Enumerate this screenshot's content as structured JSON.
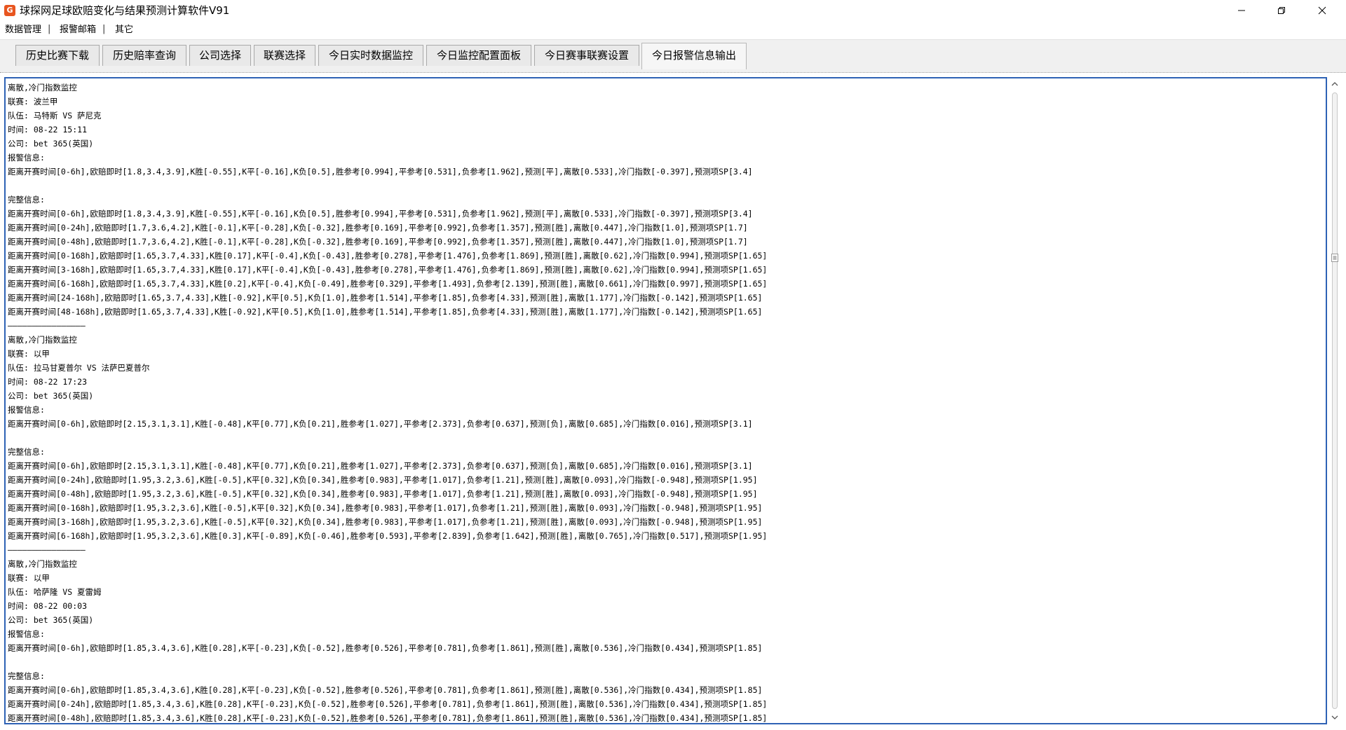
{
  "window": {
    "icon_glyph": "G",
    "title": "球探网足球欧赔变化与结果预测计算软件V91",
    "controls": [
      "minimize-icon",
      "restore-icon",
      "close-icon"
    ]
  },
  "menu": {
    "items": [
      "数据管理",
      "报警邮箱",
      "其它"
    ],
    "separator": "|"
  },
  "tabs": [
    {
      "label": "历史比赛下载",
      "active": false
    },
    {
      "label": "历史赔率查询",
      "active": false
    },
    {
      "label": "公司选择",
      "active": false
    },
    {
      "label": "联赛选择",
      "active": false
    },
    {
      "label": "今日实时数据监控",
      "active": false
    },
    {
      "label": "今日监控配置面板",
      "active": false
    },
    {
      "label": "今日赛事联赛设置",
      "active": false
    },
    {
      "label": "今日报警信息输出",
      "active": true
    }
  ],
  "colors": {
    "accent_border": "#2e62b5",
    "tab_bg": "#e9e9e9",
    "active_tab_bg": "#f6f6f6"
  },
  "log_lines": [
    "离散,冷门指数监控",
    "联赛: 波兰甲",
    "队伍: 马特斯 VS 萨尼克",
    "时间: 08-22 15:11",
    "公司: bet 365(英国)",
    "报警信息:",
    "距离开赛时间[0-6h],欧赔即时[1.8,3.4,3.9],K胜[-0.55],K平[-0.16],K负[0.5],胜参考[0.994],平参考[0.531],负参考[1.962],预测[平],离散[0.533],冷门指数[-0.397],预测项SP[3.4]",
    "",
    "完整信息:",
    "距离开赛时间[0-6h],欧赔即时[1.8,3.4,3.9],K胜[-0.55],K平[-0.16],K负[0.5],胜参考[0.994],平参考[0.531],负参考[1.962],预测[平],离散[0.533],冷门指数[-0.397],预测项SP[3.4]",
    "距离开赛时间[0-24h],欧赔即时[1.7,3.6,4.2],K胜[-0.1],K平[-0.28],K负[-0.32],胜参考[0.169],平参考[0.992],负参考[1.357],预测[胜],离散[0.447],冷门指数[1.0],预测项SP[1.7]",
    "距离开赛时间[0-48h],欧赔即时[1.7,3.6,4.2],K胜[-0.1],K平[-0.28],K负[-0.32],胜参考[0.169],平参考[0.992],负参考[1.357],预测[胜],离散[0.447],冷门指数[1.0],预测项SP[1.7]",
    "距离开赛时间[0-168h],欧赔即时[1.65,3.7,4.33],K胜[0.17],K平[-0.4],K负[-0.43],胜参考[0.278],平参考[1.476],负参考[1.869],预测[胜],离散[0.62],冷门指数[0.994],预测项SP[1.65]",
    "距离开赛时间[3-168h],欧赔即时[1.65,3.7,4.33],K胜[0.17],K平[-0.4],K负[-0.43],胜参考[0.278],平参考[1.476],负参考[1.869],预测[胜],离散[0.62],冷门指数[0.994],预测项SP[1.65]",
    "距离开赛时间[6-168h],欧赔即时[1.65,3.7,4.33],K胜[0.2],K平[-0.4],K负[-0.49],胜参考[0.329],平参考[1.493],负参考[2.139],预测[胜],离散[0.661],冷门指数[0.997],预测项SP[1.65]",
    "距离开赛时间[24-168h],欧赔即时[1.65,3.7,4.33],K胜[-0.92],K平[0.5],K负[1.0],胜参考[1.514],平参考[1.85],负参考[4.33],预测[胜],离散[1.177],冷门指数[-0.142],预测项SP[1.65]",
    "距离开赛时间[48-168h],欧赔即时[1.65,3.7,4.33],K胜[-0.92],K平[0.5],K负[1.0],胜参考[1.514],平参考[1.85],负参考[4.33],预测[胜],离散[1.177],冷门指数[-0.142],预测项SP[1.65]",
    "————————————————",
    "离散,冷门指数监控",
    "联赛: 以甲",
    "队伍: 拉马甘夏普尔 VS 法萨巴夏普尔",
    "时间: 08-22 17:23",
    "公司: bet 365(英国)",
    "报警信息:",
    "距离开赛时间[0-6h],欧赔即时[2.15,3.1,3.1],K胜[-0.48],K平[0.77],K负[0.21],胜参考[1.027],平参考[2.373],负参考[0.637],预测[负],离散[0.685],冷门指数[0.016],预测项SP[3.1]",
    "",
    "完整信息:",
    "距离开赛时间[0-6h],欧赔即时[2.15,3.1,3.1],K胜[-0.48],K平[0.77],K负[0.21],胜参考[1.027],平参考[2.373],负参考[0.637],预测[负],离散[0.685],冷门指数[0.016],预测项SP[3.1]",
    "距离开赛时间[0-24h],欧赔即时[1.95,3.2,3.6],K胜[-0.5],K平[0.32],K负[0.34],胜参考[0.983],平参考[1.017],负参考[1.21],预测[胜],离散[0.093],冷门指数[-0.948],预测项SP[1.95]",
    "距离开赛时间[0-48h],欧赔即时[1.95,3.2,3.6],K胜[-0.5],K平[0.32],K负[0.34],胜参考[0.983],平参考[1.017],负参考[1.21],预测[胜],离散[0.093],冷门指数[-0.948],预测项SP[1.95]",
    "距离开赛时间[0-168h],欧赔即时[1.95,3.2,3.6],K胜[-0.5],K平[0.32],K负[0.34],胜参考[0.983],平参考[1.017],负参考[1.21],预测[胜],离散[0.093],冷门指数[-0.948],预测项SP[1.95]",
    "距离开赛时间[3-168h],欧赔即时[1.95,3.2,3.6],K胜[-0.5],K平[0.32],K负[0.34],胜参考[0.983],平参考[1.017],负参考[1.21],预测[胜],离散[0.093],冷门指数[-0.948],预测项SP[1.95]",
    "距离开赛时间[6-168h],欧赔即时[1.95,3.2,3.6],K胜[0.3],K平[-0.89],K负[-0.46],胜参考[0.593],平参考[2.839],负参考[1.642],预测[胜],离散[0.765],冷门指数[0.517],预测项SP[1.95]",
    "————————————————",
    "离散,冷门指数监控",
    "联赛: 以甲",
    "队伍: 哈萨隆 VS 夏雷姆",
    "时间: 08-22 00:03",
    "公司: bet 365(英国)",
    "报警信息:",
    "距离开赛时间[0-6h],欧赔即时[1.85,3.4,3.6],K胜[0.28],K平[-0.23],K负[-0.52],胜参考[0.526],平参考[0.781],负参考[1.861],预测[胜],离散[0.536],冷门指数[0.434],预测项SP[1.85]",
    "",
    "完整信息:",
    "距离开赛时间[0-6h],欧赔即时[1.85,3.4,3.6],K胜[0.28],K平[-0.23],K负[-0.52],胜参考[0.526],平参考[0.781],负参考[1.861],预测[胜],离散[0.536],冷门指数[0.434],预测项SP[1.85]",
    "距离开赛时间[0-24h],欧赔即时[1.85,3.4,3.6],K胜[0.28],K平[-0.23],K负[-0.52],胜参考[0.526],平参考[0.781],负参考[1.861],预测[胜],离散[0.536],冷门指数[0.434],预测项SP[1.85]",
    "距离开赛时间[0-48h],欧赔即时[1.85,3.4,3.6],K胜[0.28],K平[-0.23],K负[-0.52],胜参考[0.526],平参考[0.781],负参考[1.861],预测[胜],离散[0.536],冷门指数[0.434],预测项SP[1.85]"
  ]
}
